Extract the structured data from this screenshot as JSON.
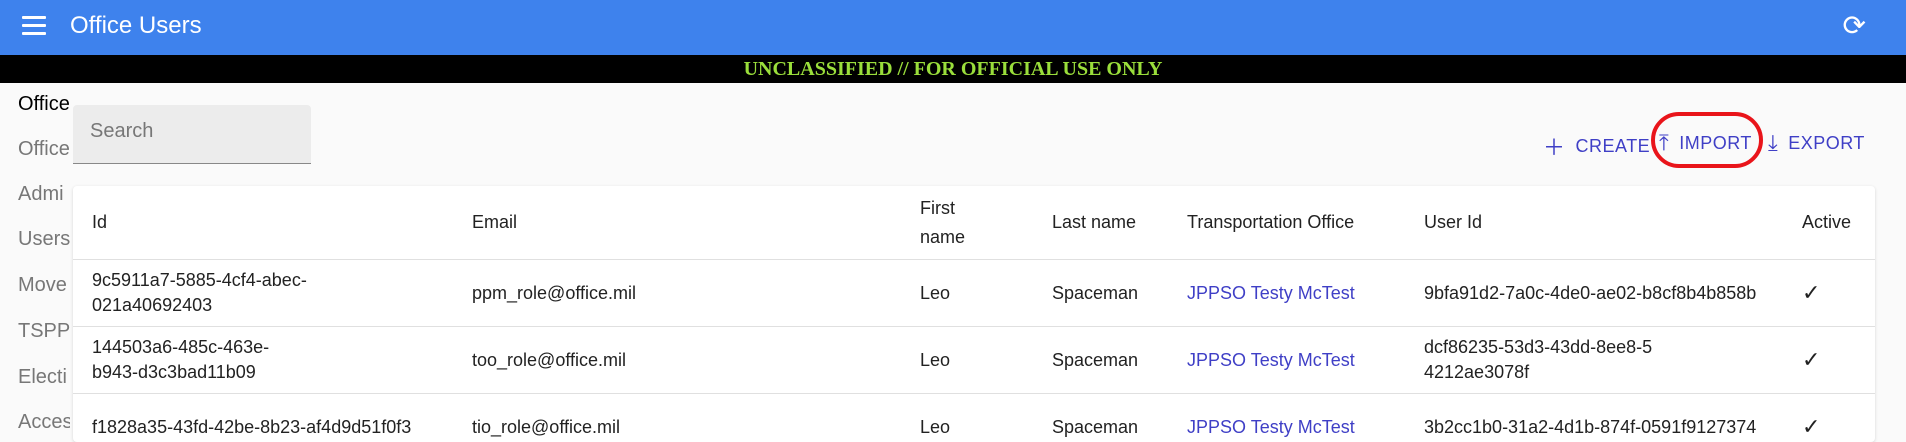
{
  "appbar": {
    "title": "Office Users",
    "menu_icon": "menu-icon",
    "refresh_icon": "refresh-icon"
  },
  "banner": {
    "text": "UNCLASSIFIED // FOR OFFICIAL USE ONLY"
  },
  "sidebar": {
    "items": [
      {
        "label": "Office"
      },
      {
        "label": "Office"
      },
      {
        "label": "Admi"
      },
      {
        "label": "Users"
      },
      {
        "label": "Move"
      },
      {
        "label": "TSPP"
      },
      {
        "label": "Electi"
      },
      {
        "label": "Acces"
      }
    ]
  },
  "search": {
    "placeholder": "Search"
  },
  "actions": {
    "create": "CREATE",
    "import": "IMPORT",
    "export": "EXPORT"
  },
  "table": {
    "headers": {
      "id": "Id",
      "email": "Email",
      "first_name": "First name",
      "last_name": "Last name",
      "office": "Transportation Office",
      "user_id": "User Id",
      "active": "Active"
    },
    "rows": [
      {
        "id": "9c5911a7-5885-4cf4-abec-021a40692403",
        "email": "ppm_role@office.mil",
        "first_name": "Leo",
        "last_name": "Spaceman",
        "office": "JPPSO Testy McTest",
        "user_id": "9bfa91d2-7a0c-4de0-ae02-b8cf8b4b858b",
        "active": "✓"
      },
      {
        "id": "144503a6-485c-463e-b943-d3c3bad11b09",
        "email": "too_role@office.mil",
        "first_name": "Leo",
        "last_name": "Spaceman",
        "office": "JPPSO Testy McTest",
        "user_id": "dcf86235-53d3-43dd-8ee8-54212ae3078f",
        "active": "✓"
      },
      {
        "id": "f1828a35-43fd-42be-8b23-af4d9d51f0f3",
        "email": "tio_role@office.mil",
        "first_name": "Leo",
        "last_name": "Spaceman",
        "office": "JPPSO Testy McTest",
        "user_id": "3b2cc1b0-31a2-4d1b-874f-0591f9127374",
        "active": "✓"
      }
    ]
  }
}
